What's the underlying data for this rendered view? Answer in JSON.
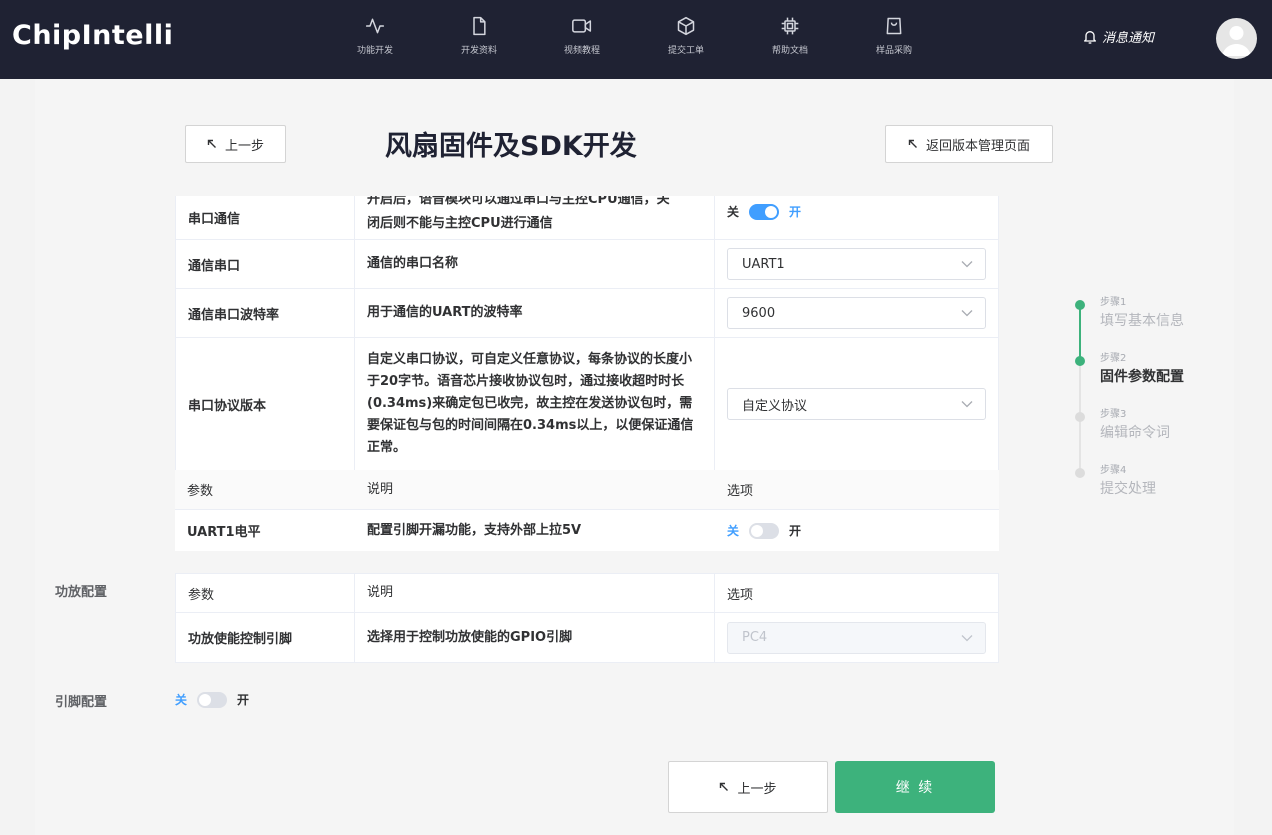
{
  "brand": "ChipIntelli",
  "nav": [
    {
      "label": "功能开发",
      "icon": "activity-icon"
    },
    {
      "label": "开发资料",
      "icon": "file-icon"
    },
    {
      "label": "视频教程",
      "icon": "video-icon"
    },
    {
      "label": "提交工单",
      "icon": "box-icon"
    },
    {
      "label": "帮助文档",
      "icon": "chip-icon"
    },
    {
      "label": "样品采购",
      "icon": "shopping-bag-icon"
    }
  ],
  "notify_label": "消息通知",
  "header": {
    "prev_label": "上一步",
    "title": "风扇固件及SDK开发",
    "back_label": "返回版本管理页面"
  },
  "serial_table": {
    "rows": [
      {
        "param": "串口通信",
        "desc_line1": "开启后，语音模块可以通过串口与主控CPU通信，关",
        "desc_line2": "闭后则不能与主控CPU进行通信",
        "off": "关",
        "on": "开",
        "enabled": true
      },
      {
        "param": "通信串口",
        "desc": "通信的串口名称",
        "value": "UART1"
      },
      {
        "param": "通信串口波特率",
        "desc": "用于通信的UART的波特率",
        "value": "9600"
      },
      {
        "param": "串口协议版本",
        "desc": "自定义串口协议，可自定义任意协议，每条协议的长度小于20字节。语音芯片接收协议包时，通过接收超时时长(0.34ms)来确定包已收完，故主控在发送协议包时，需要保证包与包的时间间隔在0.34ms以上，以便保证通信正常。",
        "value": "自定义协议"
      }
    ]
  },
  "uart_table": {
    "headers": [
      "参数",
      "说明",
      "选项"
    ],
    "row": {
      "param": "UART1电平",
      "desc": "配置引脚开漏功能，支持外部上拉5V",
      "off": "关",
      "on": "开",
      "enabled": false
    }
  },
  "amp_section": {
    "label": "功放配置",
    "headers": [
      "参数",
      "说明",
      "选项"
    ],
    "row": {
      "param": "功放使能控制引脚",
      "desc": "选择用于控制功放使能的GPIO引脚",
      "value": "PC4"
    }
  },
  "pin_section": {
    "label": "引脚配置",
    "off": "关",
    "on": "开",
    "enabled": false
  },
  "steps": [
    {
      "num": "步骤1",
      "title": "填写基本信息",
      "state": "done"
    },
    {
      "num": "步骤2",
      "title": "固件参数配置",
      "state": "current"
    },
    {
      "num": "步骤3",
      "title": "编辑命令词",
      "state": "pending"
    },
    {
      "num": "步骤4",
      "title": "提交处理",
      "state": "pending"
    }
  ],
  "footer": {
    "prev_label": "上一步",
    "continue_label": "继 续"
  },
  "colors": {
    "nav_bg": "#1f2233",
    "accent_green": "#3db27c",
    "switch_blue": "#409eff"
  }
}
